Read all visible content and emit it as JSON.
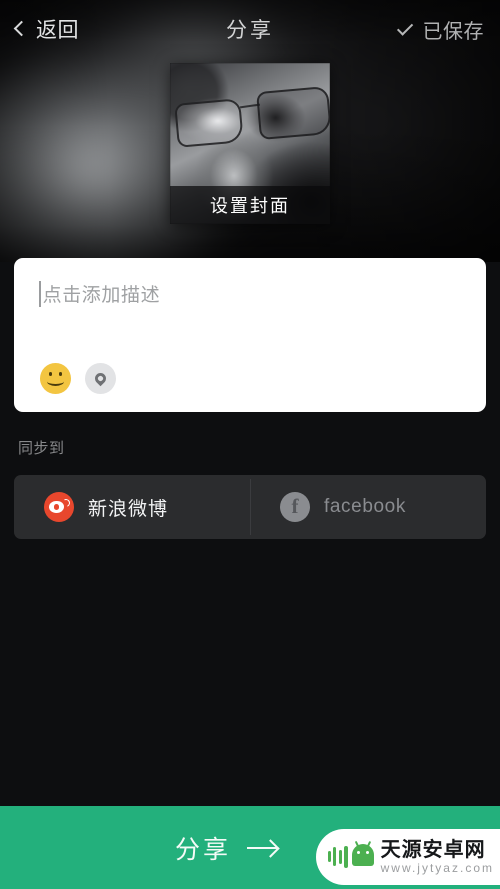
{
  "header": {
    "back_label": "返回",
    "back_icon": "chevron-left-icon",
    "title": "分享",
    "saved_label": "已保存",
    "saved_icon": "check-icon"
  },
  "cover": {
    "caption": "设置封面",
    "image_alt": "grayscale portrait of a person wearing glasses"
  },
  "description": {
    "placeholder": "点击添加描述",
    "value": "",
    "emoji_icon": "emoji-smiley-icon",
    "location_icon": "location-pin-icon"
  },
  "sync": {
    "label": "同步到",
    "targets": [
      {
        "name": "新浪微博",
        "icon": "weibo-icon",
        "active": true,
        "color": "#e8472d"
      },
      {
        "name": "facebook",
        "icon": "facebook-icon",
        "active": false,
        "color": "#8a8c90"
      }
    ]
  },
  "share_bar": {
    "label": "分享",
    "arrow_icon": "arrow-right-icon",
    "color": "#23b07c"
  },
  "watermark": {
    "title": "天源安卓网",
    "url": "www.jytyaz.com",
    "logo_icon": "android-robot-icon"
  }
}
